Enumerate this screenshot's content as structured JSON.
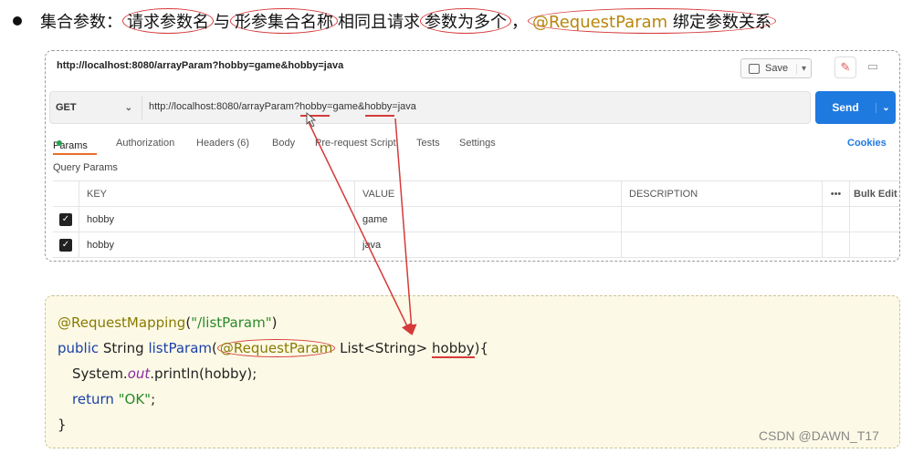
{
  "heading": {
    "text_1": "集合参数：",
    "text_2": "请求参数名",
    "text_3": "与",
    "text_4": "形参集合名称",
    "text_5": "相同且请求",
    "text_6": "参数为多个",
    "text_7": "，",
    "text_8": "@RequestParam",
    "text_9": " 绑定参数关系"
  },
  "postman": {
    "title": "http://localhost:8080/arrayParam?hobby=game&hobby=java",
    "save_label": "Save",
    "method": "GET",
    "url": "http://localhost:8080/arrayParam?hobby=game&hobby=java",
    "send_label": "Send",
    "tabs": [
      "Params",
      "Authorization",
      "Headers (6)",
      "Body",
      "Pre-request Script",
      "Tests",
      "Settings"
    ],
    "cookies_label": "Cookies",
    "query_params_label": "Query Params",
    "table": {
      "headers": [
        "KEY",
        "VALUE",
        "DESCRIPTION",
        "•••",
        "Bulk Edit"
      ],
      "rows": [
        {
          "key": "hobby",
          "value": "game",
          "description": ""
        },
        {
          "key": "hobby",
          "value": "java",
          "description": ""
        }
      ]
    },
    "colors": {
      "send": "#1f7ae0",
      "active_tab": "#e86f28",
      "params_dot": "#21a34b"
    }
  },
  "code": {
    "line1_annot": "@RequestMapping",
    "line1_rest_open": "(",
    "line1_string": "\"/listParam\"",
    "line1_rest_close": ")",
    "line2_kw": "public",
    "line2_type": " String ",
    "line2_fn": "listParam",
    "line2_open": "(",
    "line2_annot": "@RequestParam",
    "line2_type2": " List<String> ",
    "line2_param": "hobby",
    "line2_close": "){",
    "line3_obj": "System.",
    "line3_field": "out",
    "line3_call": ".println(hobby);",
    "line4_kw": "return",
    "line4_string": " \"OK\"",
    "line4_end": ";",
    "line5": "}"
  },
  "watermark": "CSDN @DAWN_T17",
  "annotation_color": "#d63a3a"
}
